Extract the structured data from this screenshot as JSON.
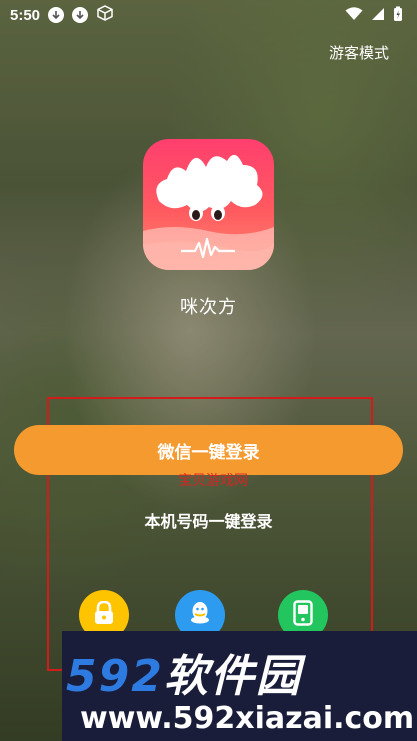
{
  "status_bar": {
    "time": "5:50"
  },
  "header": {
    "guest_mode": "游客模式"
  },
  "app": {
    "name": "咪次方"
  },
  "login": {
    "wechat_button": "微信一键登录",
    "phone_quick_login": "本机号码一键登录"
  },
  "overlay": {
    "watermark_text": "宝贝游戏网",
    "banner_digits": "592",
    "banner_title": "软件园",
    "banner_url": "www.592xiazai.com"
  },
  "colors": {
    "wechat_button": "#f59a2f",
    "lock_icon_bg": "#ffc400",
    "qq_icon_bg": "#2d9cf0",
    "phone_icon_bg": "#22c55e",
    "watermark_box": "#d21c1c"
  }
}
